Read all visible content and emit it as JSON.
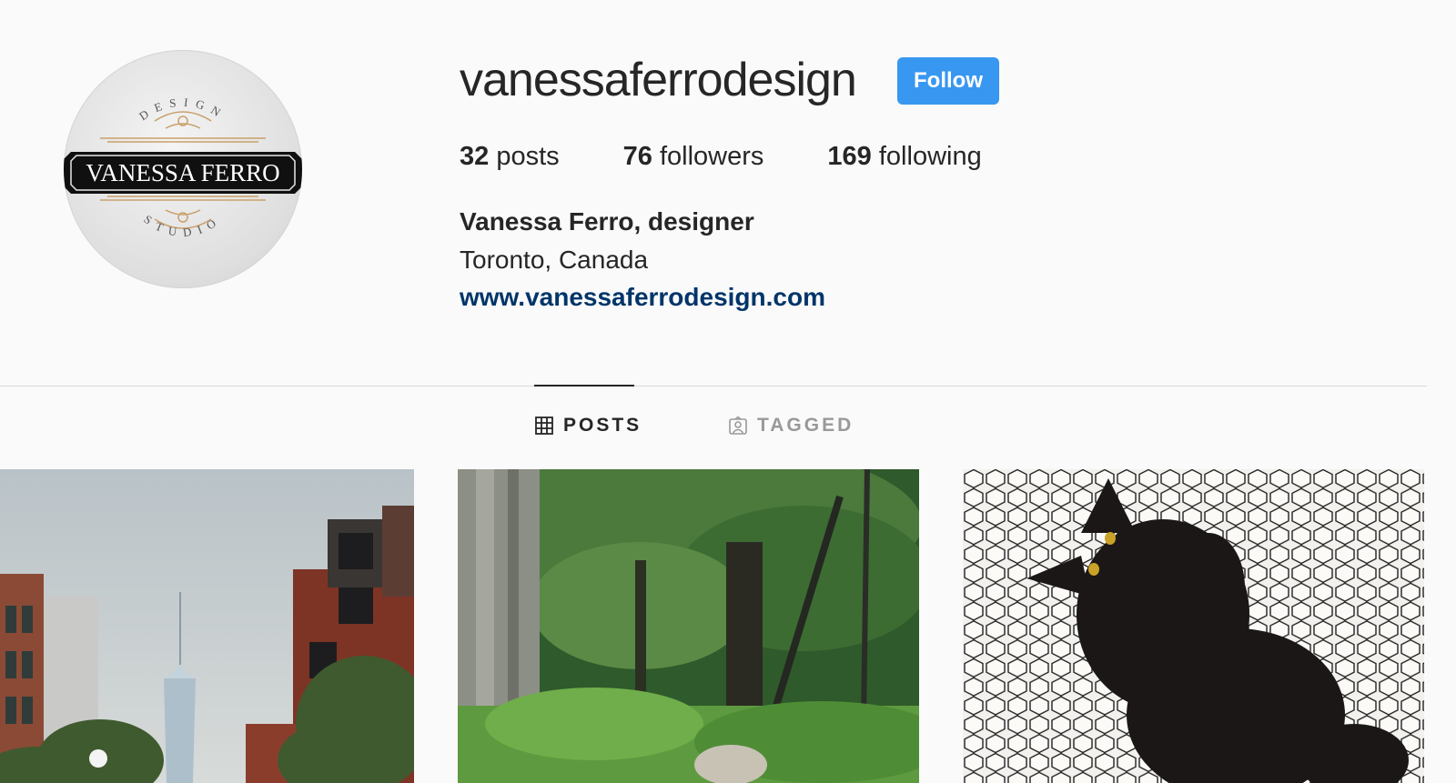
{
  "profile": {
    "username": "vanessaferrodesign",
    "follow_label": "Follow",
    "avatar": {
      "top_text": "DESIGN",
      "banner_text": "VANESSA FERRO",
      "bottom_text": "STUDIO"
    },
    "stats": {
      "posts": {
        "count": "32",
        "label": "posts"
      },
      "followers": {
        "count": "76",
        "label": "followers"
      },
      "following": {
        "count": "169",
        "label": "following"
      }
    },
    "full_name": "Vanessa Ferro, designer",
    "location": "Toronto, Canada",
    "website": "www.vanessaferrodesign.com"
  },
  "tabs": [
    {
      "label": "POSTS",
      "icon": "grid-icon",
      "active": true
    },
    {
      "label": "TAGGED",
      "icon": "tagged-person-icon",
      "active": false
    }
  ],
  "posts": [
    {
      "subject": "city-skyline-photo"
    },
    {
      "subject": "forest-photo"
    },
    {
      "subject": "black-cat-photo"
    }
  ],
  "colors": {
    "follow_button": "#3897f0",
    "link": "#003569",
    "background": "#fafafa",
    "text": "#262626",
    "inactive_tab": "#999999"
  }
}
